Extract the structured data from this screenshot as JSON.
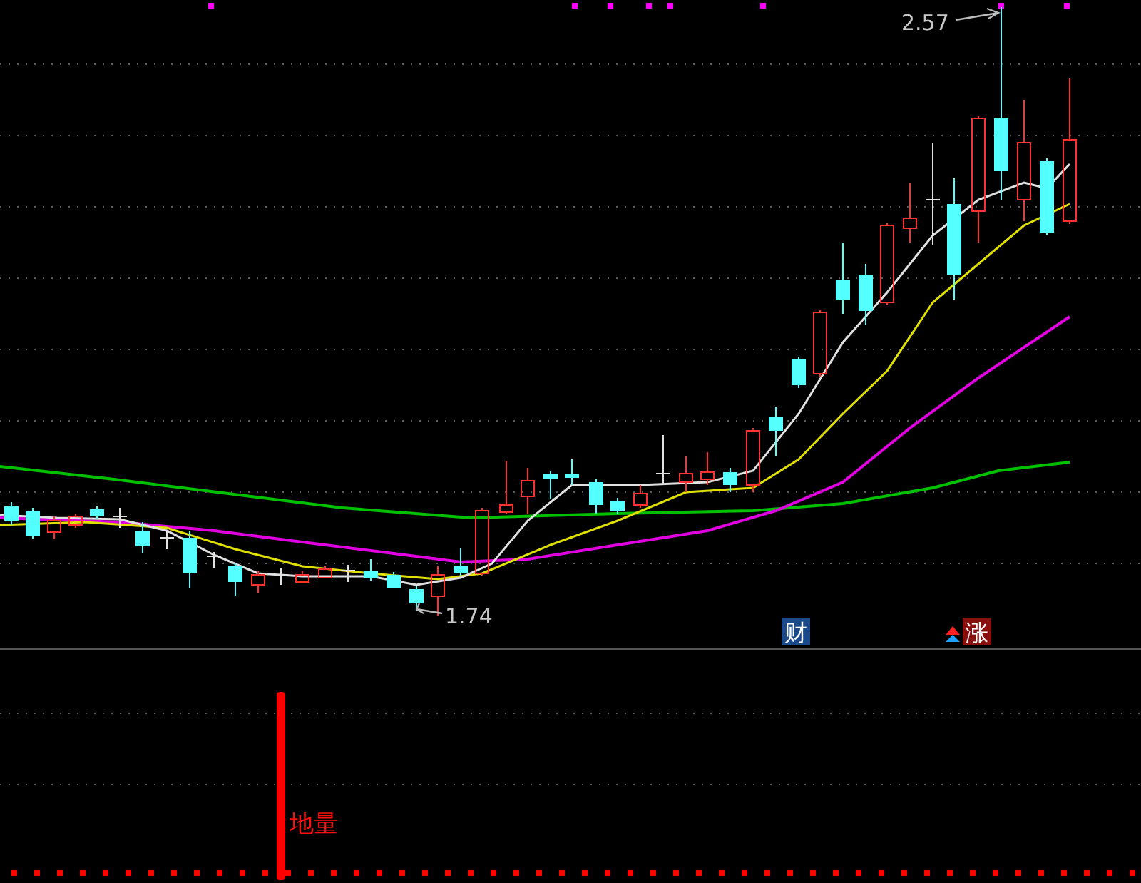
{
  "price_chart": {
    "high_label": "2.57",
    "low_label": "1.74",
    "signals": [
      {
        "kind": "finance",
        "text": "财"
      },
      {
        "kind": "rise",
        "text": "涨"
      }
    ]
  },
  "indicator_panel": {
    "label": "地量"
  }
}
